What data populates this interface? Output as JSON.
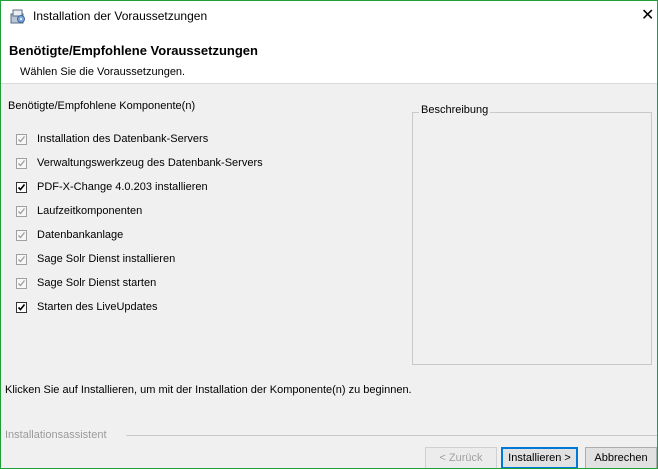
{
  "window": {
    "title": "Installation der Voraussetzungen",
    "close_glyph": "✕"
  },
  "header": {
    "title": "Benötigte/Empfohlene Voraussetzungen",
    "subtitle": "Wählen Sie die Voraussetzungen."
  },
  "components": {
    "group_label": "Benötigte/Empfohlene Komponente(n)",
    "items": [
      {
        "label": "Installation des Datenbank-Servers",
        "checked": true,
        "enabled": false
      },
      {
        "label": "Verwaltungswerkzeug des Datenbank-Servers",
        "checked": true,
        "enabled": false
      },
      {
        "label": "PDF-X-Change 4.0.203 installieren",
        "checked": true,
        "enabled": true
      },
      {
        "label": "Laufzeitkomponenten",
        "checked": true,
        "enabled": false
      },
      {
        "label": "Datenbankanlage",
        "checked": true,
        "enabled": false
      },
      {
        "label": "Sage Solr Dienst installieren",
        "checked": true,
        "enabled": false
      },
      {
        "label": "Sage Solr Dienst starten",
        "checked": true,
        "enabled": false
      },
      {
        "label": "Starten des LiveUpdates",
        "checked": true,
        "enabled": true
      }
    ]
  },
  "description": {
    "label": "Beschreibung"
  },
  "instruction": "Klicken Sie auf Installieren, um mit der Installation der Komponente(n) zu beginnen.",
  "footer": {
    "wizard_label": "Installationsassistent",
    "back_label": "< Zurück",
    "install_label": "Installieren >",
    "cancel_label": "Abbrechen"
  },
  "colors": {
    "window_border": "#1f9e3c",
    "focus_border": "#0078d7",
    "disabled_text": "#a0a0a0"
  },
  "icons": {
    "app": "installer-icon",
    "close": "close-icon",
    "check": "checkmark-icon"
  }
}
